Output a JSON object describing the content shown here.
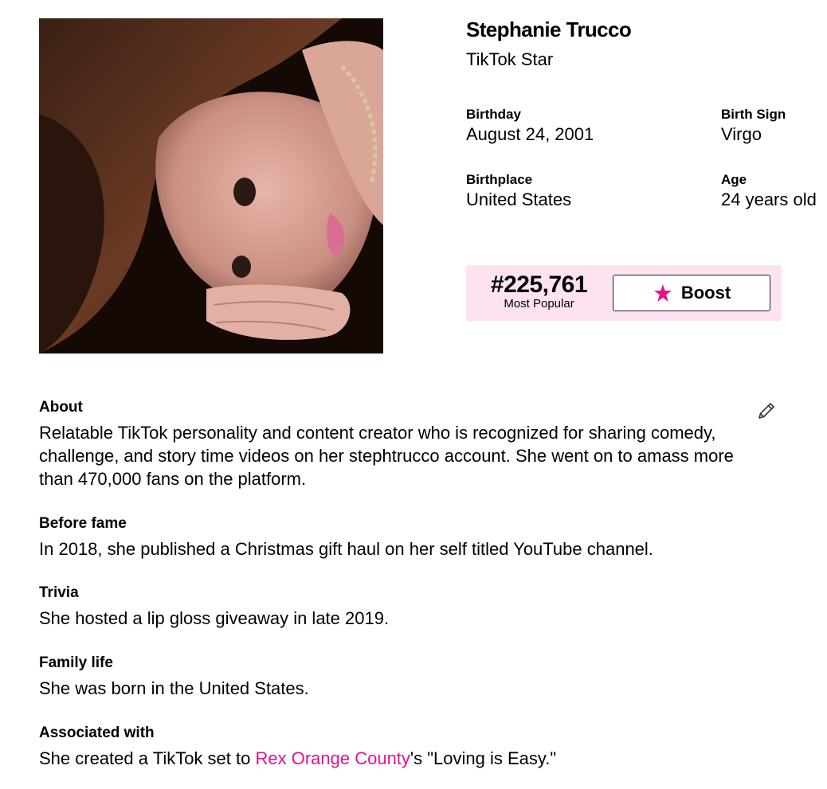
{
  "profile": {
    "name": "Stephanie Trucco",
    "profession": "TikTok Star",
    "photo_icon": "portrait-photo",
    "next_icon": "arrow-right-icon"
  },
  "facts": {
    "birthday_label": "Birthday",
    "birthday_value": "August 24, 2001",
    "sign_label": "Birth Sign",
    "sign_value": "Virgo",
    "place_label": "Birthplace",
    "place_value": "United States",
    "age_label": "Age",
    "age_value": "24 years old"
  },
  "rank": {
    "number": "#225,761",
    "label": "Most Popular",
    "boost_label": "Boost",
    "boost_icon": "star-icon",
    "accent_color": "#e3128f",
    "box_color": "#fde2f1"
  },
  "about": {
    "title": "About",
    "text": "Relatable TikTok personality and content creator who is recognized for sharing comedy, challenge, and story time videos on her stephtrucco account. She went on to amass more than 470,000 fans on the platform.",
    "edit_icon": "pencil-icon"
  },
  "before_fame": {
    "title": "Before fame",
    "text": "In 2018, she published a Christmas gift haul on her self titled YouTube channel."
  },
  "trivia": {
    "title": "Trivia",
    "text": "She hosted a lip gloss giveaway in late 2019."
  },
  "family_life": {
    "title": "Family life",
    "text": "She was born in the United States."
  },
  "associated": {
    "title": "Associated with",
    "text_before": "She created a TikTok set to ",
    "link_text": "Rex Orange County",
    "text_after": "'s \"Loving is Easy.\"",
    "link_color": "#e3128f"
  }
}
